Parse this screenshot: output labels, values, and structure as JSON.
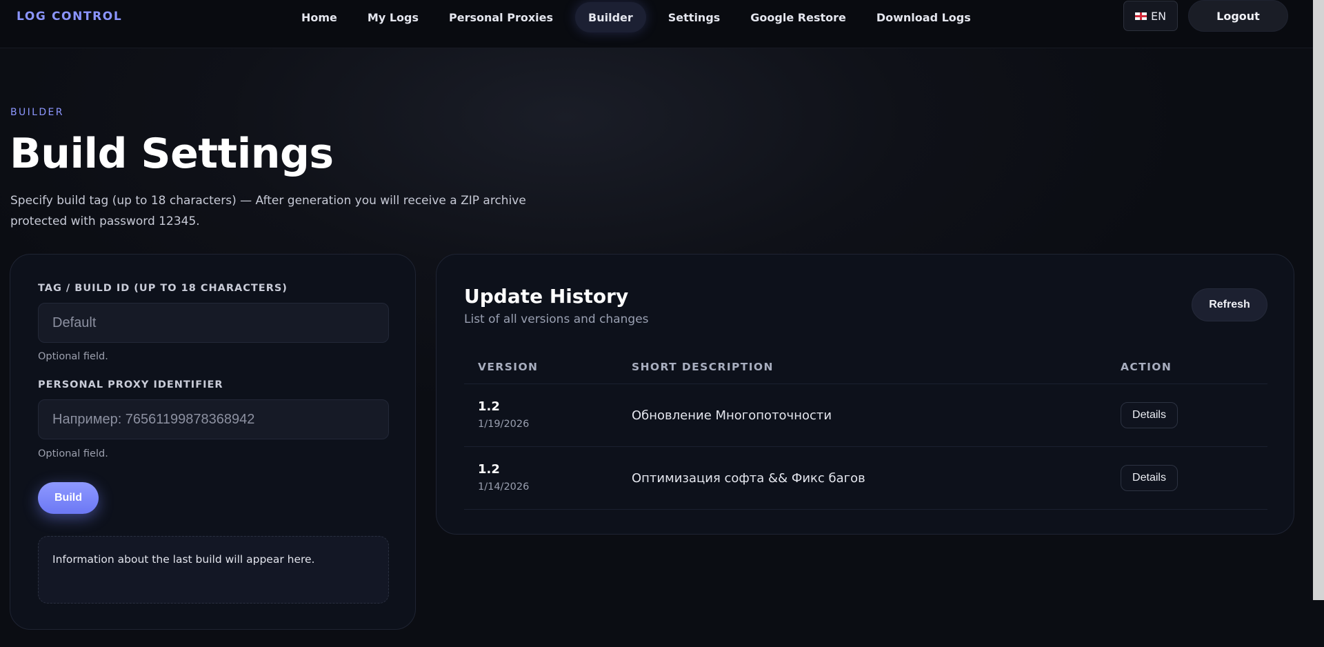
{
  "header": {
    "brand": "LOG CONTROL",
    "nav": [
      "Home",
      "My Logs",
      "Personal Proxies",
      "Builder",
      "Settings",
      "Google Restore",
      "Download Logs"
    ],
    "active_nav": "Builder",
    "language": "EN",
    "logout_label": "Logout"
  },
  "page": {
    "eyebrow": "BUILDER",
    "title": "Build Settings",
    "subtitle": "Specify build tag (up to 18 characters) — After generation you will receive a ZIP archive protected with password 12345."
  },
  "build_form": {
    "tag_label": "TAG / BUILD ID (UP TO 18 CHARACTERS)",
    "tag_placeholder": "Default",
    "tag_hint": "Optional field.",
    "proxy_label": "PERSONAL PROXY IDENTIFIER",
    "proxy_placeholder": "Например: 76561199878368942",
    "proxy_hint": "Optional field.",
    "build_button": "Build",
    "info_text": "Information about the last build will appear here."
  },
  "update_history": {
    "title": "Update History",
    "subtitle": "List of all versions and changes",
    "refresh_label": "Refresh",
    "columns": [
      "VERSION",
      "SHORT DESCRIPTION",
      "ACTION"
    ],
    "rows": [
      {
        "version": "1.2",
        "date": "1/19/2026",
        "description": "Обновление Многопоточности",
        "action": "Details"
      },
      {
        "version": "1.2",
        "date": "1/14/2026",
        "description": "Оптимизация софта && Фикс багов",
        "action": "Details"
      }
    ]
  },
  "colors": {
    "accent": "#8b95ff",
    "background": "#0f1118",
    "card": "#0d111b"
  }
}
